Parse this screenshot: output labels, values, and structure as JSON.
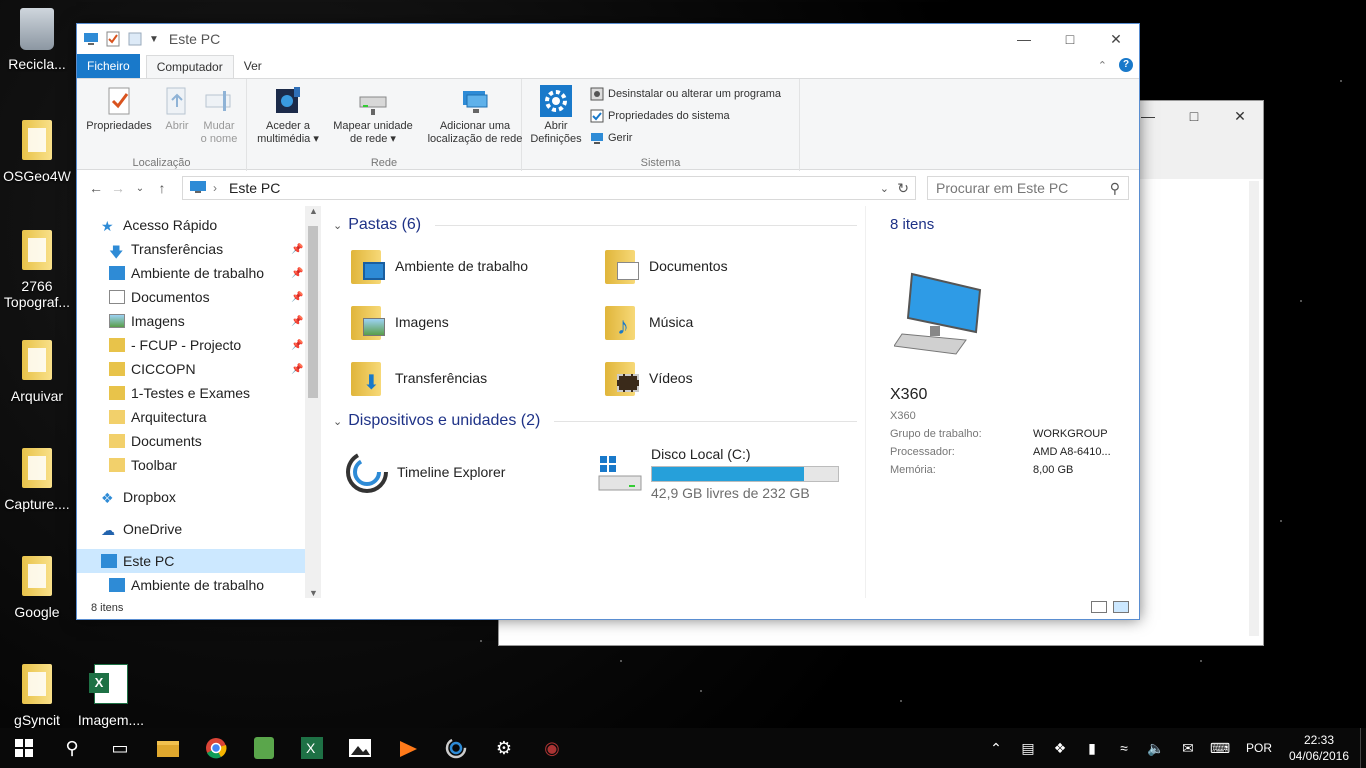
{
  "desktop": {
    "icons": [
      {
        "label": "Recicla..."
      },
      {
        "label": "OSGeo4W"
      },
      {
        "label": "2766"
      },
      {
        "label": "Topograf..."
      },
      {
        "label": "Arquivar"
      },
      {
        "label": "Capture...."
      },
      {
        "label": "Google"
      },
      {
        "label": "gSyncit"
      },
      {
        "label": "Imagem...."
      }
    ]
  },
  "window": {
    "title": "Este PC",
    "tabs": {
      "file": "Ficheiro",
      "computer": "Computador",
      "view": "Ver"
    },
    "ribbon": {
      "location": {
        "label": "Localização",
        "properties": "Propriedades",
        "open": "Abrir",
        "rename_1": "Mudar",
        "rename_2": "o nome"
      },
      "network": {
        "label": "Rede",
        "media_1": "Aceder a",
        "media_2": "multimédia",
        "map_1": "Mapear unidade",
        "map_2": "de rede",
        "add_1": "Adicionar uma",
        "add_2": "localização de rede"
      },
      "system": {
        "label": "Sistema",
        "settings_1": "Abrir",
        "settings_2": "Definições",
        "uninstall": "Desinstalar ou alterar um programa",
        "sysprops": "Propriedades do sistema",
        "manage": "Gerir"
      }
    },
    "address": {
      "path": "Este PC",
      "search_placeholder": "Procurar em Este PC"
    },
    "nav": {
      "items": [
        {
          "label": "Acesso Rápido"
        },
        {
          "label": "Transferências"
        },
        {
          "label": "Ambiente de trabalho"
        },
        {
          "label": "Documentos"
        },
        {
          "label": "Imagens"
        },
        {
          "label": "- FCUP - Projecto"
        },
        {
          "label": "CICCOPN"
        },
        {
          "label": "1-Testes e Exames"
        },
        {
          "label": "Arquitectura"
        },
        {
          "label": "Documents"
        },
        {
          "label": "Toolbar"
        },
        {
          "label": "Dropbox"
        },
        {
          "label": "OneDrive"
        },
        {
          "label": "Este PC"
        },
        {
          "label": "Ambiente de trabalho"
        }
      ]
    },
    "content": {
      "folders_header": "Pastas (6)",
      "folders": [
        {
          "label": "Ambiente de trabalho"
        },
        {
          "label": "Documentos"
        },
        {
          "label": "Imagens"
        },
        {
          "label": "Música"
        },
        {
          "label": "Transferências"
        },
        {
          "label": "Vídeos"
        }
      ],
      "devices_header": "Dispositivos e unidades (2)",
      "timeline": "Timeline Explorer",
      "disk": {
        "name": "Disco Local (C:)",
        "free": "42,9 GB livres de 232 GB",
        "used_fraction": 0.815
      }
    },
    "details": {
      "count": "8 itens",
      "name": "X360",
      "subname": "X360",
      "rows": [
        {
          "key": "Grupo de trabalho:",
          "value": "WORKGROUP"
        },
        {
          "key": "Processador:",
          "value": "AMD A8-6410..."
        },
        {
          "key": "Memória:",
          "value": "8,00 GB"
        }
      ]
    },
    "status": "8 itens"
  },
  "taskbar": {
    "lang": "POR",
    "time": "22:33",
    "date": "04/06/2016"
  },
  "colors": {
    "accent": "#1979ca",
    "selection": "#cce8ff",
    "disk_fill": "#26a0da",
    "section_header": "#1e3287"
  }
}
